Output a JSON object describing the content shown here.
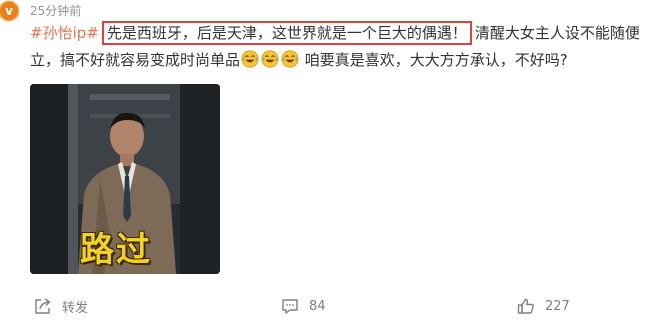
{
  "header": {
    "avatar_badge": "v",
    "timestamp": "25分钟前"
  },
  "content": {
    "hashtag": "#孙怡ip#",
    "highlighted_text": "先是西班牙，后是天津，这世界就是一个巨大的偶遇！",
    "text_after_highlight": "清醒大女主人设不能随便立，搞不好就容易变成时尚单品",
    "text_after_emoji": "咱要真是喜欢，大大方方承认，不好吗?",
    "emoji_names": [
      "laughing-crying-emoji",
      "laughing-crying-emoji",
      "laughing-crying-emoji"
    ]
  },
  "image": {
    "caption": "路过",
    "caption_color": "#f4d21f"
  },
  "footer": {
    "repost_label": "转发",
    "comment_count": "84",
    "like_count": "227"
  },
  "colors": {
    "hashtag": "#eb7350",
    "highlight_border": "#e04040",
    "muted_text": "#939393",
    "badge": "#e8811a"
  }
}
